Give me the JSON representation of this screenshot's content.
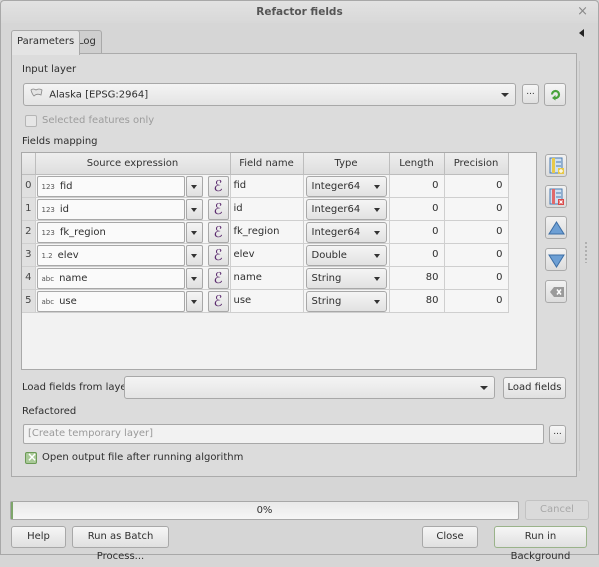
{
  "window": {
    "title": "Refactor fields",
    "close_label": "×"
  },
  "tabs": [
    {
      "label": "Parameters",
      "active": true
    },
    {
      "label": "Log",
      "active": false
    }
  ],
  "input_layer": {
    "label": "Input layer",
    "value": "Alaska [EPSG:2964]",
    "layer_icon": "polygon-layer-icon",
    "browse_label": "...",
    "iterate_icon": "refresh-icon"
  },
  "selected_features": {
    "label": "Selected features only",
    "checked": false,
    "enabled": false
  },
  "fields_mapping": {
    "label": "Fields mapping",
    "columns": [
      "Source expression",
      "Field name",
      "Type",
      "Length",
      "Precision"
    ],
    "rows": [
      {
        "index": "0",
        "type_icon": "123",
        "source": "fid",
        "field_name": "fid",
        "type": "Integer64",
        "length": "0",
        "precision": "0"
      },
      {
        "index": "1",
        "type_icon": "123",
        "source": "id",
        "field_name": "id",
        "type": "Integer64",
        "length": "0",
        "precision": "0"
      },
      {
        "index": "2",
        "type_icon": "123",
        "source": "fk_region",
        "field_name": "fk_region",
        "type": "Integer64",
        "length": "0",
        "precision": "0"
      },
      {
        "index": "3",
        "type_icon": "1.2",
        "source": "elev",
        "field_name": "elev",
        "type": "Double",
        "length": "0",
        "precision": "0"
      },
      {
        "index": "4",
        "type_icon": "abc",
        "source": "name",
        "field_name": "name",
        "type": "String",
        "length": "80",
        "precision": "0"
      },
      {
        "index": "5",
        "type_icon": "abc",
        "source": "use",
        "field_name": "use",
        "type": "String",
        "length": "80",
        "precision": "0"
      }
    ],
    "expression_glyph": "ℰ",
    "side_buttons": [
      "add-field-icon",
      "delete-field-icon",
      "move-up-icon",
      "move-down-icon",
      "reset-icon"
    ]
  },
  "load_fields": {
    "label": "Load fields from layer",
    "value": "",
    "button_label": "Load fields"
  },
  "refactored": {
    "label": "Refactored",
    "placeholder": "[Create temporary layer]",
    "browse_label": "..."
  },
  "open_output": {
    "label": "Open output file after running algorithm",
    "checked": true
  },
  "progress": {
    "value_percent": 0,
    "text": "0%"
  },
  "buttons": {
    "cancel": "Cancel",
    "help": "Help",
    "batch": "Run as Batch Process...",
    "close": "Close",
    "run": "Run in Background"
  },
  "colors": {
    "accent_green": "#7da66a",
    "expression_purple": "#5b2b6e",
    "arrow_blue": "#5a8fc9"
  }
}
